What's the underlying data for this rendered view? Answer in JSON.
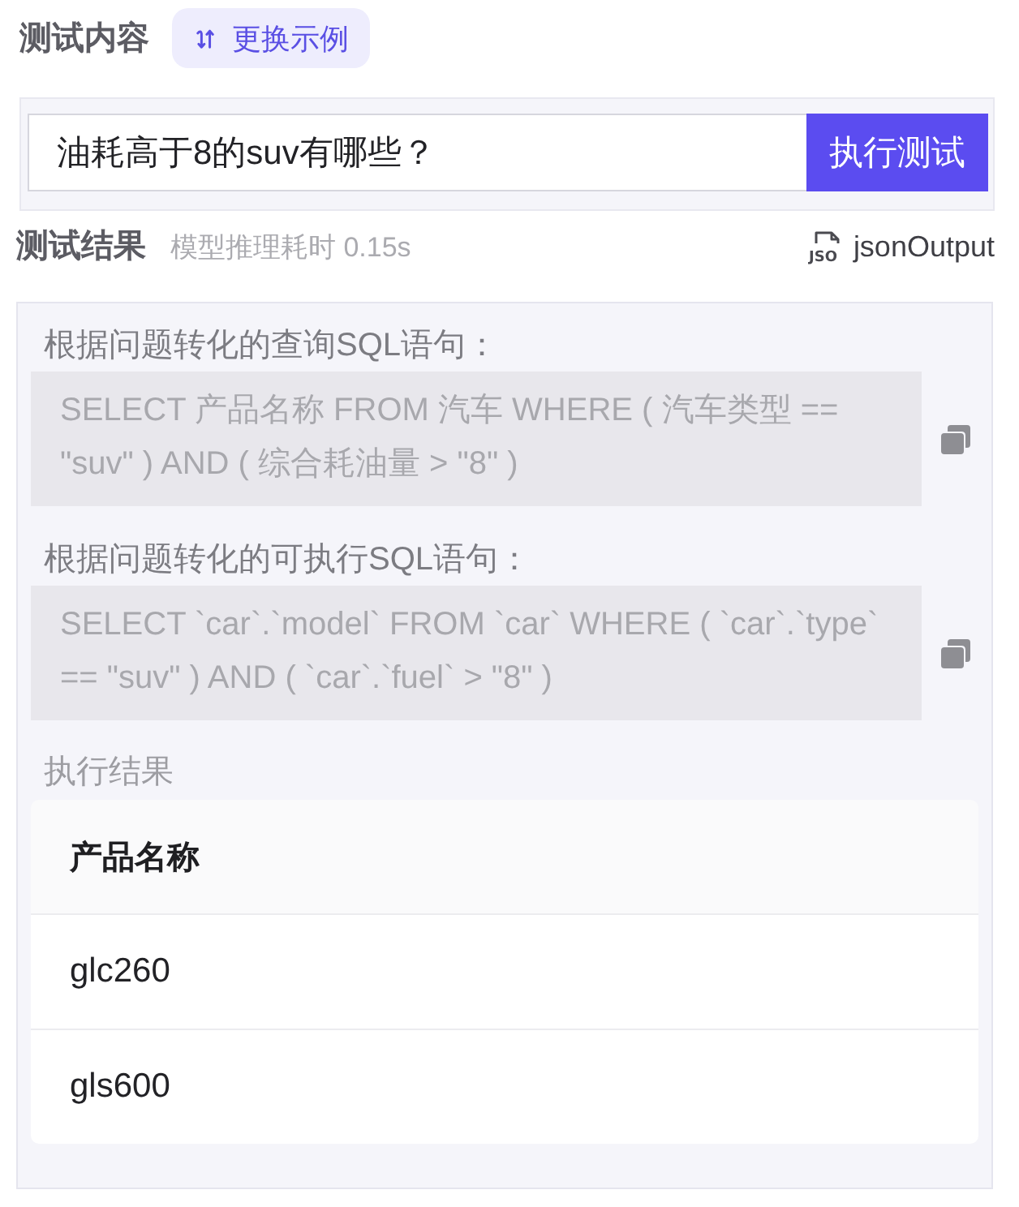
{
  "header": {
    "title": "测试内容",
    "example_button": "更换示例"
  },
  "query": {
    "value": "油耗高于8的suv有哪些？",
    "submit_button": "执行测试"
  },
  "result_header": {
    "title": "测试结果",
    "timing": "模型推理耗时 0.15s",
    "json_icon_label": "JSO",
    "json_output_button": "jsonOutput"
  },
  "sql_blocks": [
    {
      "label": "根据问题转化的查询SQL语句：",
      "code": "SELECT 产品名称 FROM 汽车 WHERE ( 汽车类型 == \"suv\" ) AND ( 综合耗油量 > \"8\" )"
    },
    {
      "label": "根据问题转化的可执行SQL语句：",
      "code": "SELECT `car`.`model` FROM `car` WHERE ( `car`.`type` == \"suv\" ) AND ( `car`.`fuel` > \"8\" )"
    }
  ],
  "execution": {
    "label": "执行结果",
    "table": {
      "columns": [
        "产品名称"
      ],
      "rows": [
        [
          "glc260"
        ],
        [
          "gls600"
        ]
      ]
    }
  }
}
